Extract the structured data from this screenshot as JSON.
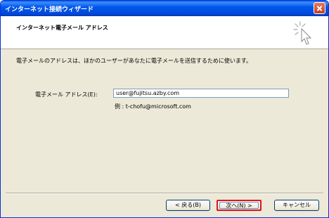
{
  "window": {
    "title": "インターネット接続ウィザード"
  },
  "header": {
    "title": "インターネット電子メール アドレス",
    "icon": "wizard-wand-icon"
  },
  "main": {
    "description": "電子メールのアドレスは、ほかのユーザーがあなたに電子メールを送信するために使います。",
    "email_label": "電子メール アドレス(E):",
    "email_value": "user@fujitsu.azby.com",
    "example": "例 : t-chofu@microsoft.com"
  },
  "buttons": {
    "back": "< 戻る(B)",
    "next": "次へ(N) >",
    "cancel": "キャンセル"
  }
}
